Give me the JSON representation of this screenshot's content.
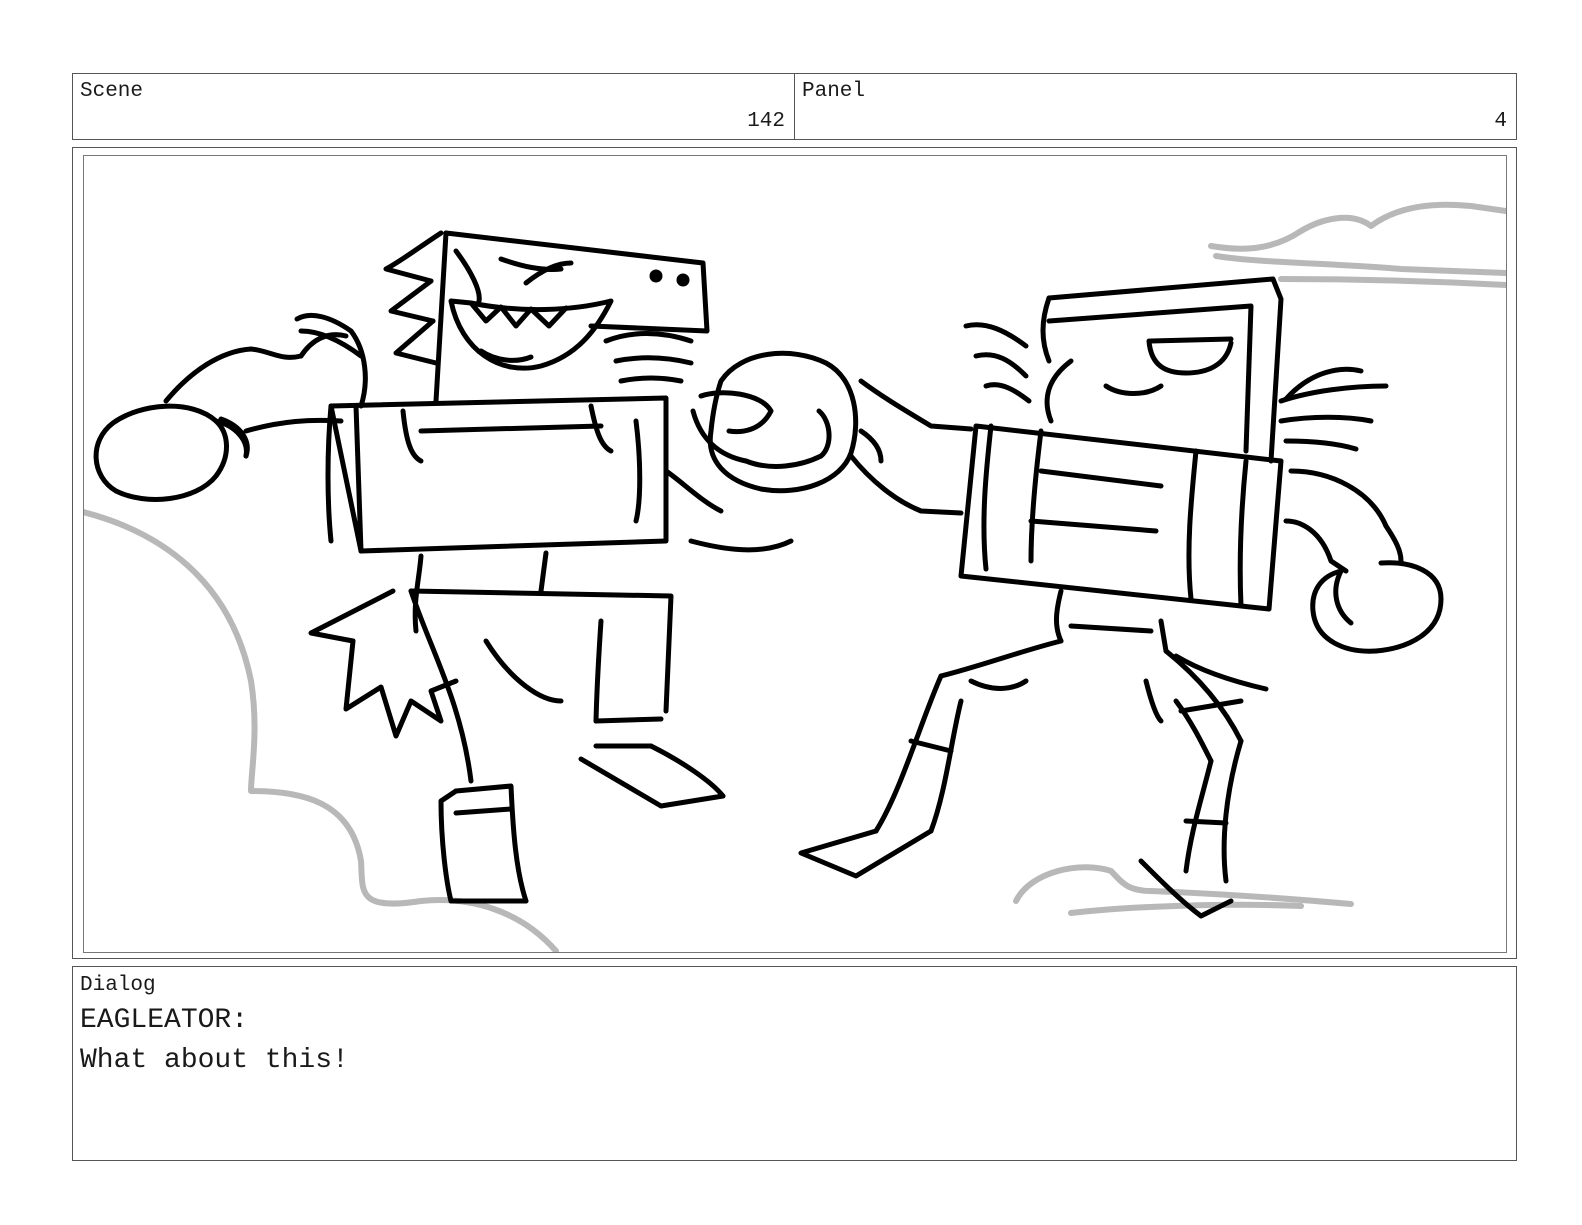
{
  "header": {
    "scene_label": "Scene",
    "scene_number": "142",
    "panel_label": "Panel",
    "panel_number": "4"
  },
  "drawing": {
    "description_icon": "storyboard-sketch",
    "stroke_color": "#000000",
    "background_stroke_color": "#b8b8b8"
  },
  "dialog": {
    "label": "Dialog",
    "speaker": "EAGLEATOR:",
    "line": "What about this!"
  }
}
